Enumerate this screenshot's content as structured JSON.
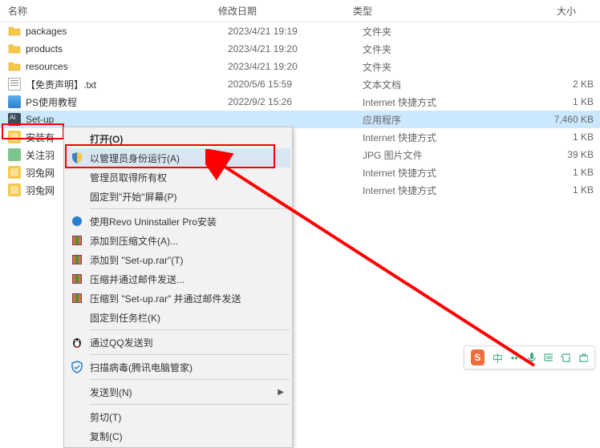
{
  "header": {
    "name": "名称",
    "date": "修改日期",
    "type": "类型",
    "size": "大小"
  },
  "files": [
    {
      "icon": "folder",
      "name": "packages",
      "date": "2023/4/21 19:19",
      "type": "文件夹",
      "size": ""
    },
    {
      "icon": "folder",
      "name": "products",
      "date": "2023/4/21 19:20",
      "type": "文件夹",
      "size": ""
    },
    {
      "icon": "folder",
      "name": "resources",
      "date": "2023/4/21 19:20",
      "type": "文件夹",
      "size": ""
    },
    {
      "icon": "txt",
      "name": "【免责声明】.txt",
      "date": "2020/5/6 15:59",
      "type": "文本文档",
      "size": "2 KB"
    },
    {
      "icon": "html",
      "name": "PS使用教程",
      "date": "2022/9/2 15:26",
      "type": "Internet 快捷方式",
      "size": "1 KB"
    },
    {
      "icon": "exe",
      "name": "Set-up",
      "date": "",
      "type": "应用程序",
      "size": "7,460 KB",
      "selected": true
    },
    {
      "icon": "yellow",
      "name": "安装有",
      "date": "",
      "type": "Internet 快捷方式",
      "size": "1 KB"
    },
    {
      "icon": "jpg",
      "name": "关注羽",
      "date": "",
      "type": "JPG 图片文件",
      "size": "39 KB"
    },
    {
      "icon": "yellow",
      "name": "羽兔网",
      "date": "",
      "type": "Internet 快捷方式",
      "size": "1 KB"
    },
    {
      "icon": "yellow",
      "name": "羽兔网",
      "date": "",
      "type": "Internet 快捷方式",
      "size": "1 KB"
    }
  ],
  "menu": {
    "items": [
      {
        "label": "打开(O)",
        "bold": true
      },
      {
        "label": "以管理员身份运行(A)",
        "icon": "shield",
        "hover": true
      },
      {
        "label": "管理员取得所有权"
      },
      {
        "label": "固定到\"开始\"屏幕(P)"
      },
      {
        "sep": true
      },
      {
        "label": "使用Revo Uninstaller Pro安装",
        "icon": "revo"
      },
      {
        "label": "添加到压缩文件(A)...",
        "icon": "rar"
      },
      {
        "label": "添加到 \"Set-up.rar\"(T)",
        "icon": "rar"
      },
      {
        "label": "压缩并通过邮件发送...",
        "icon": "rar"
      },
      {
        "label": "压缩到 \"Set-up.rar\" 并通过邮件发送",
        "icon": "rar"
      },
      {
        "label": "固定到任务栏(K)"
      },
      {
        "sep": true
      },
      {
        "label": "通过QQ发送到",
        "icon": "qq"
      },
      {
        "sep": true
      },
      {
        "label": "扫描病毒(腾讯电脑管家)",
        "icon": "tencent"
      },
      {
        "sep": true
      },
      {
        "label": "发送到(N)",
        "arrow": true
      },
      {
        "sep": true
      },
      {
        "label": "剪切(T)"
      },
      {
        "label": "复制(C)"
      }
    ]
  },
  "ime": {
    "logo": "S",
    "lang": "中"
  }
}
